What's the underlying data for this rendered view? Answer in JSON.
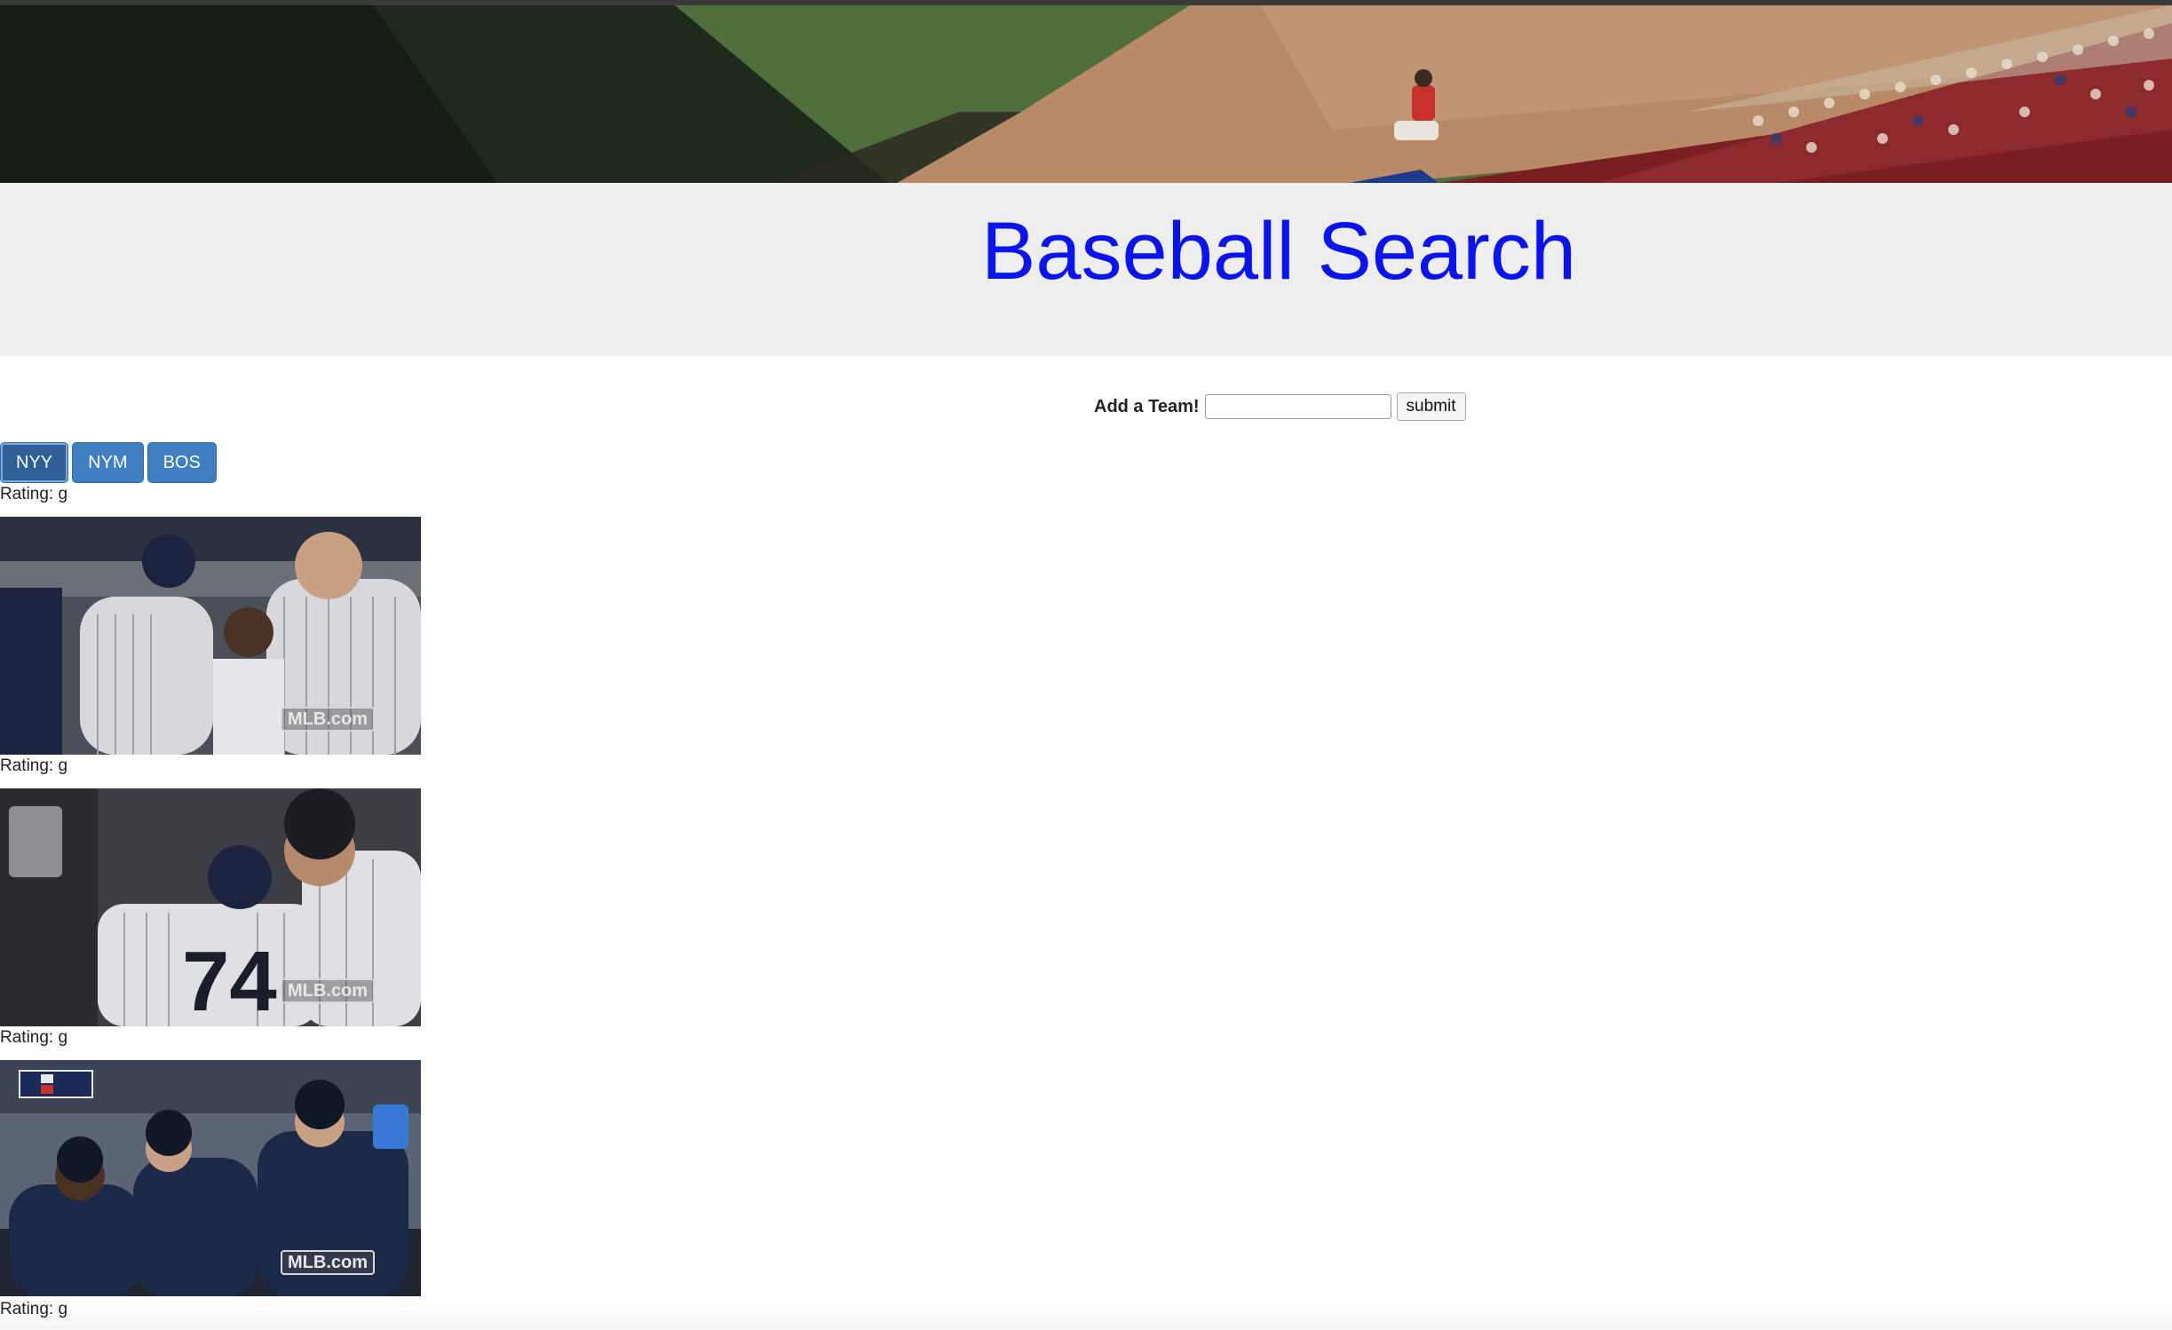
{
  "page": {
    "title": "Baseball Search"
  },
  "form": {
    "label": "Add a Team!",
    "input_value": "",
    "input_placeholder": "",
    "submit_label": "submit"
  },
  "teams": {
    "buttons": [
      {
        "label": "NYY",
        "active": true
      },
      {
        "label": "NYM",
        "active": false
      },
      {
        "label": "BOS",
        "active": false
      }
    ]
  },
  "results": [
    {
      "rating": "Rating: g",
      "watermark": "MLB.com"
    },
    {
      "rating": "Rating: g",
      "watermark": "MLB.com"
    },
    {
      "rating": "Rating: g",
      "watermark": "MLB.com"
    },
    {
      "rating": "Rating: g"
    }
  ],
  "colors": {
    "title": "#0a14f0",
    "jumbotron": "#eeeeee",
    "team_button": "#3f7ec0",
    "team_button_active": "#2e5f95"
  }
}
